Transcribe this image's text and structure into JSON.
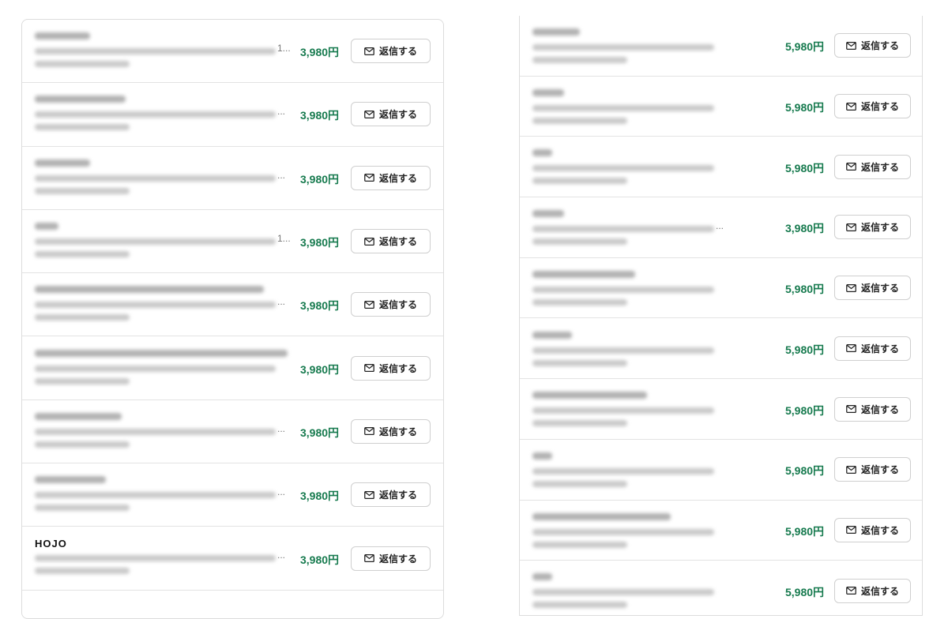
{
  "left": {
    "rows": [
      {
        "price": "3,980円",
        "reply_label": "返信する",
        "trail": "1..."
      },
      {
        "price": "3,980円",
        "reply_label": "返信する",
        "trail": "..."
      },
      {
        "price": "3,980円",
        "reply_label": "返信する",
        "trail": "..."
      },
      {
        "price": "3,980円",
        "reply_label": "返信する",
        "trail": "1..."
      },
      {
        "price": "3,980円",
        "reply_label": "返信する",
        "trail": "..."
      },
      {
        "price": "3,980円",
        "reply_label": "返信する",
        "trail": ""
      },
      {
        "price": "3,980円",
        "reply_label": "返信する",
        "trail": "..."
      },
      {
        "price": "3,980円",
        "reply_label": "返信する",
        "trail": "..."
      },
      {
        "price": "3,980円",
        "reply_label": "返信する",
        "trail": "...",
        "name": "HOJO"
      }
    ]
  },
  "right": {
    "rows": [
      {
        "price": "5,980円",
        "reply_label": "返信する",
        "trail": ""
      },
      {
        "price": "5,980円",
        "reply_label": "返信する",
        "trail": ""
      },
      {
        "price": "5,980円",
        "reply_label": "返信する",
        "trail": ""
      },
      {
        "price": "3,980円",
        "reply_label": "返信する",
        "trail": "..."
      },
      {
        "price": "5,980円",
        "reply_label": "返信する",
        "trail": ""
      },
      {
        "price": "5,980円",
        "reply_label": "返信する",
        "trail": ""
      },
      {
        "price": "5,980円",
        "reply_label": "返信する",
        "trail": ""
      },
      {
        "price": "5,980円",
        "reply_label": "返信する",
        "trail": ""
      },
      {
        "price": "5,980円",
        "reply_label": "返信する",
        "trail": ""
      },
      {
        "price": "5,980円",
        "reply_label": "返信する",
        "trail": ""
      }
    ]
  },
  "colors": {
    "price": "#167a4e",
    "border": "#dcdcdc"
  },
  "icons": {
    "reply": "mail-icon"
  }
}
